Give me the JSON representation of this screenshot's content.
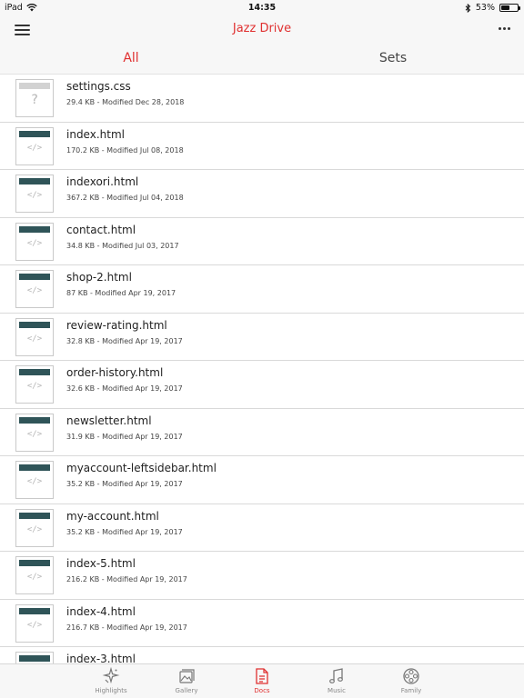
{
  "status_bar": {
    "device": "iPad",
    "time": "14:35",
    "battery_text": "53%",
    "battery_level": 0.53
  },
  "nav": {
    "title": "Jazz Drive"
  },
  "segments": [
    {
      "label": "All",
      "active": true
    },
    {
      "label": "Sets",
      "active": false
    }
  ],
  "files": [
    {
      "name": "settings.css",
      "meta": "29.4 KB - Modified Dec 28, 2018",
      "icon": "unknown-file-icon"
    },
    {
      "name": "index.html",
      "meta": "170.2 KB - Modified Jul 08, 2018",
      "icon": "html-file-icon"
    },
    {
      "name": "indexori.html",
      "meta": "367.2 KB - Modified Jul 04, 2018",
      "icon": "html-file-icon"
    },
    {
      "name": "contact.html",
      "meta": "34.8 KB - Modified Jul 03, 2017",
      "icon": "html-file-icon"
    },
    {
      "name": "shop-2.html",
      "meta": "87 KB - Modified Apr 19, 2017",
      "icon": "html-file-icon"
    },
    {
      "name": "review-rating.html",
      "meta": "32.8 KB - Modified Apr 19, 2017",
      "icon": "html-file-icon"
    },
    {
      "name": "order-history.html",
      "meta": "32.6 KB - Modified Apr 19, 2017",
      "icon": "html-file-icon"
    },
    {
      "name": "newsletter.html",
      "meta": "31.9 KB - Modified Apr 19, 2017",
      "icon": "html-file-icon"
    },
    {
      "name": "myaccount-leftsidebar.html",
      "meta": "35.2 KB - Modified Apr 19, 2017",
      "icon": "html-file-icon"
    },
    {
      "name": "my-account.html",
      "meta": "35.2 KB - Modified Apr 19, 2017",
      "icon": "html-file-icon"
    },
    {
      "name": "index-5.html",
      "meta": "216.2 KB - Modified Apr 19, 2017",
      "icon": "html-file-icon"
    },
    {
      "name": "index-4.html",
      "meta": "216.7 KB - Modified Apr 19, 2017",
      "icon": "html-file-icon"
    },
    {
      "name": "index-3.html",
      "meta": "",
      "icon": "html-file-icon"
    }
  ],
  "tabs": [
    {
      "label": "Highlights",
      "icon": "sparkle-icon",
      "active": false
    },
    {
      "label": "Gallery",
      "icon": "gallery-icon",
      "active": false
    },
    {
      "label": "Docs",
      "icon": "document-icon",
      "active": true
    },
    {
      "label": "Music",
      "icon": "music-note-icon",
      "active": false
    },
    {
      "label": "Family",
      "icon": "film-reel-icon",
      "active": false
    }
  ],
  "colors": {
    "accent": "#e03030",
    "thumb_bar": "#2f5458",
    "bar_background": "#f7f7f7"
  }
}
